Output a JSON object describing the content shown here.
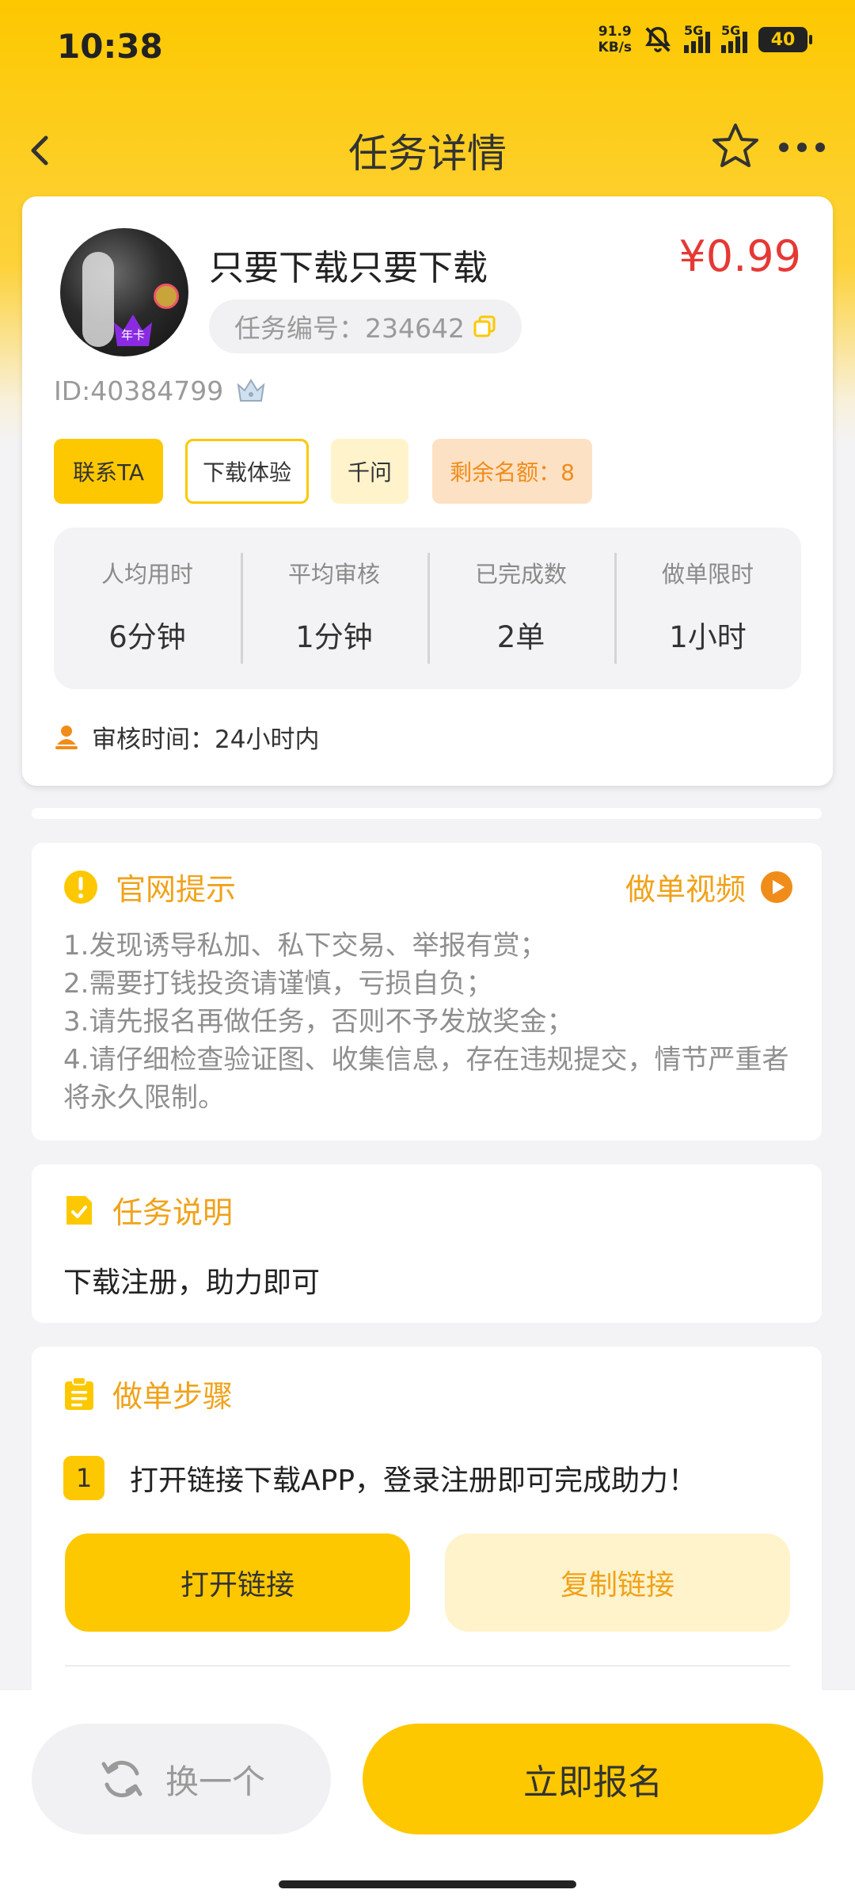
{
  "status_bar": {
    "time": "10:38",
    "net_speed_value": "91.9",
    "net_speed_unit": "KB/s",
    "signal_1": "5G",
    "signal_2": "5G",
    "battery": "40"
  },
  "nav": {
    "title": "任务详情"
  },
  "task": {
    "title": "只要下载只要下载",
    "price": "¥0.99",
    "task_no_label": "任务编号：234642",
    "user_id": "ID:40384799",
    "avatar_badge": "年卡"
  },
  "tags": {
    "contact": "联系TA",
    "download": "下载体验",
    "qianwen": "千问",
    "remaining": "剩余名额：8"
  },
  "stats": [
    {
      "label": "人均用时",
      "value": "6分钟"
    },
    {
      "label": "平均审核",
      "value": "1分钟"
    },
    {
      "label": "已完成数",
      "value": "2单"
    },
    {
      "label": "做单限时",
      "value": "1小时"
    }
  ],
  "review_time": "审核时间：24小时内",
  "notice": {
    "title": "官网提示",
    "video_label": "做单视频",
    "lines": [
      "1.发现诱导私加、私下交易、举报有赏；",
      "2.需要打钱投资请谨慎，亏损自负；",
      "3.请先报名再做任务，否则不予发放奖金；",
      "4.请仔细检查验证图、收集信息，存在违规提交，情节严重者将永久限制。"
    ]
  },
  "description": {
    "title": "任务说明",
    "text": "下载注册，助力即可"
  },
  "steps": {
    "title": "做单步骤",
    "items": [
      {
        "num": "1",
        "text": "打开链接下载APP，登录注册即可完成助力！"
      }
    ],
    "open_link": "打开链接",
    "copy_link": "复制链接"
  },
  "bottom": {
    "switch_label": "换一个",
    "signup_label": "立即报名"
  },
  "colors": {
    "brand_yellow": "#fdc800",
    "price_red": "#e53935",
    "accent_orange": "#f0a21a"
  }
}
